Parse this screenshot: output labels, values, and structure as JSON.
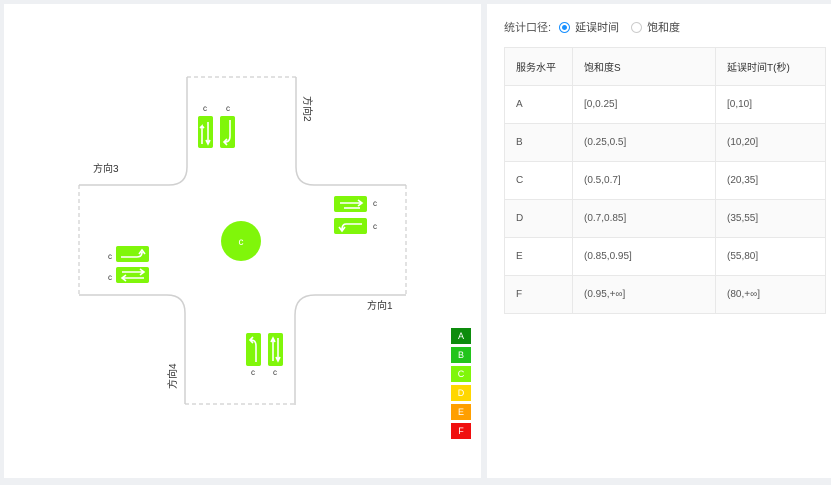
{
  "map": {
    "directions": [
      "方向1",
      "方向2",
      "方向3",
      "方向4"
    ],
    "center_label": "c",
    "lane_label": "c",
    "legend": [
      {
        "label": "A",
        "color": "#0d8c0d"
      },
      {
        "label": "B",
        "color": "#22c41c"
      },
      {
        "label": "C",
        "color": "#80f60a"
      },
      {
        "label": "D",
        "color": "#ffd700"
      },
      {
        "label": "E",
        "color": "#ff9f00"
      },
      {
        "label": "F",
        "color": "#f00f0f"
      }
    ]
  },
  "stat": {
    "label": "统计口径:",
    "options": [
      {
        "label": "延误时间",
        "checked": true
      },
      {
        "label": "饱和度",
        "checked": false
      }
    ]
  },
  "table": {
    "headers": [
      "服务水平",
      "饱和度S",
      "延误时间T(秒)"
    ],
    "rows": [
      [
        "A",
        "[0,0.25]",
        "[0,10]"
      ],
      [
        "B",
        "(0.25,0.5]",
        "(10,20]"
      ],
      [
        "C",
        "(0.5,0.7]",
        "(20,35]"
      ],
      [
        "D",
        "(0.7,0.85]",
        "(35,55]"
      ],
      [
        "E",
        "(0.85,0.95]",
        "(55,80]"
      ],
      [
        "F",
        "(0.95,+∞]",
        "(80,+∞]"
      ]
    ]
  }
}
